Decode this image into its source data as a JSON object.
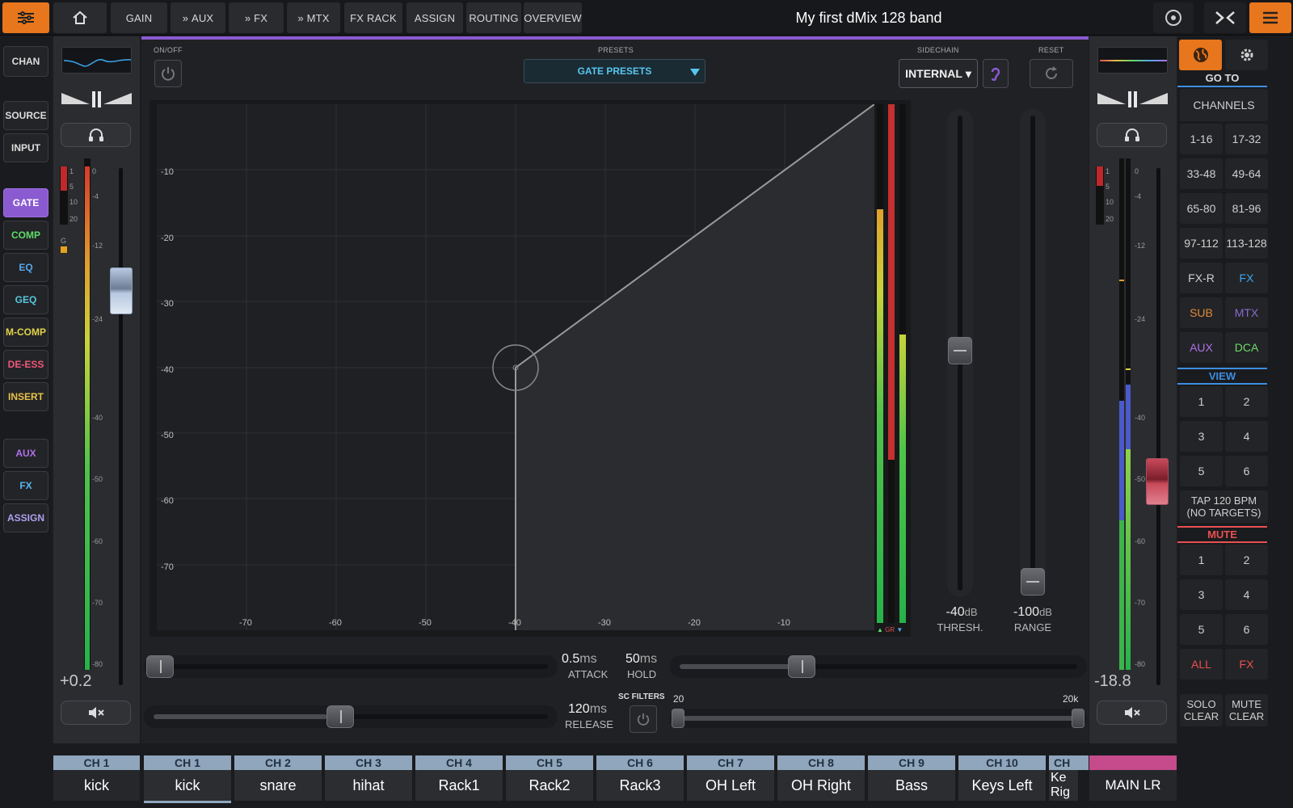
{
  "topbar": {
    "title": "My first dMix 128 band",
    "tabs": [
      "GAIN",
      "AUX",
      "FX",
      "MTX",
      "FX RACK",
      "ASSIGN",
      "ROUTING",
      "OVERVIEW"
    ],
    "aux_prefix": "»"
  },
  "leftnav": {
    "chan": "CHAN",
    "source": "SOURCE",
    "input": "INPUT",
    "gate": "GATE",
    "comp": "COMP",
    "eq": "EQ",
    "geq": "GEQ",
    "mcomp": "M-COMP",
    "deess": "DE-ESS",
    "insert": "INSERT",
    "aux": "AUX",
    "fx": "FX",
    "assign": "ASSIGN"
  },
  "strip_left": {
    "gain_value": "+0.2",
    "gr_labels": [
      "1",
      "5",
      "10",
      "20"
    ],
    "g_label": "G",
    "meter_scale": [
      "0",
      "-4",
      "-12",
      "-24",
      "-40",
      "-50",
      "-60",
      "-70",
      "-80"
    ],
    "channel_tag": "CH 1",
    "channel_name": "kick"
  },
  "gate": {
    "onoff_label": "ON/OFF",
    "presets_label": "PRESETS",
    "presets_value": "GATE PRESETS",
    "sidechain_label": "SIDECHAIN",
    "sidechain_value": "INTERNAL",
    "reset_label": "RESET",
    "y_ticks": [
      "-10",
      "-20",
      "-30",
      "-40",
      "-50",
      "-60",
      "-70"
    ],
    "x_ticks": [
      "-70",
      "-60",
      "-50",
      "-40",
      "-30",
      "-20",
      "-10"
    ],
    "gr_label": "GR",
    "threshold_value": "-40",
    "threshold_unit": "dB",
    "threshold_label": "THRESH.",
    "range_value": "-100",
    "range_unit": "dB",
    "range_label": "RANGE",
    "attack_value": "0.5",
    "attack_unit": "ms",
    "attack_label": "ATTACK",
    "hold_value": "50",
    "hold_unit": "ms",
    "hold_label": "HOLD",
    "release_value": "120",
    "release_unit": "ms",
    "release_label": "RELEASE",
    "scfilters_label": "SC FILTERS",
    "scf_low": "20",
    "scf_high": "20k"
  },
  "strip_right": {
    "gain_value": "-18.8",
    "gr_labels": [
      "1",
      "5",
      "10",
      "20"
    ],
    "meter_scale": [
      "0",
      "-4",
      "-12",
      "-24",
      "-40",
      "-50",
      "-60",
      "-70",
      "-80"
    ],
    "channel_name": "MAIN LR"
  },
  "rightpanel": {
    "goto": "GO TO",
    "channels": "CHANNELS",
    "ranges": [
      "1-16",
      "17-32",
      "33-48",
      "49-64",
      "65-80",
      "81-96",
      "97-112",
      "113-128"
    ],
    "groups": [
      "FX-R",
      "FX",
      "SUB",
      "MTX",
      "AUX",
      "DCA"
    ],
    "view": "VIEW",
    "view_buttons": [
      "1",
      "2",
      "3",
      "4",
      "5",
      "6"
    ],
    "tap_line1": "TAP 120 BPM",
    "tap_line2": "(NO TARGETS)",
    "mute": "MUTE",
    "mute_buttons": [
      "1",
      "2",
      "3",
      "4",
      "5",
      "6"
    ],
    "all": "ALL",
    "fx": "FX",
    "solo_clear_1": "SOLO",
    "solo_clear_2": "CLEAR",
    "mute_clear_1": "MUTE",
    "mute_clear_2": "CLEAR"
  },
  "bottom_tabs": [
    {
      "tag": "CH 1",
      "name": "kick"
    },
    {
      "tag": "CH 2",
      "name": "snare"
    },
    {
      "tag": "CH 3",
      "name": "hihat"
    },
    {
      "tag": "CH 4",
      "name": "Rack1"
    },
    {
      "tag": "CH 5",
      "name": "Rack2"
    },
    {
      "tag": "CH 6",
      "name": "Rack3"
    },
    {
      "tag": "CH 7",
      "name": "OH Left"
    },
    {
      "tag": "CH 8",
      "name": "OH Right"
    },
    {
      "tag": "CH 9",
      "name": "Bass"
    },
    {
      "tag": "CH 10",
      "name": "Keys Left"
    },
    {
      "tag": "CH",
      "name": "Ke Rig"
    }
  ],
  "colors": {
    "accent_orange": "#e8761c",
    "gate_purple": "#8a5ad0",
    "presets_text": "#58c6f0",
    "comp_green": "#5fdc6a",
    "eq_blue": "#56a8f0",
    "mcomp_yellow": "#e0d24a",
    "deess_pink": "#f0577a",
    "insert_yellow": "#e8c24a",
    "aux_purple": "#b070e8",
    "mute_red": "#e85050",
    "view_blue": "#3d8ee0",
    "main_lr": "#c64b8c"
  },
  "icons": [
    "settings-sliders-icon",
    "home-icon",
    "target-icon",
    "collapse-icon",
    "menu-icon",
    "power-icon",
    "headphones-icon",
    "mute-speaker-icon",
    "globe-icon",
    "gear-icon",
    "reset-icon",
    "listen-ear-icon",
    "pause-icon"
  ]
}
